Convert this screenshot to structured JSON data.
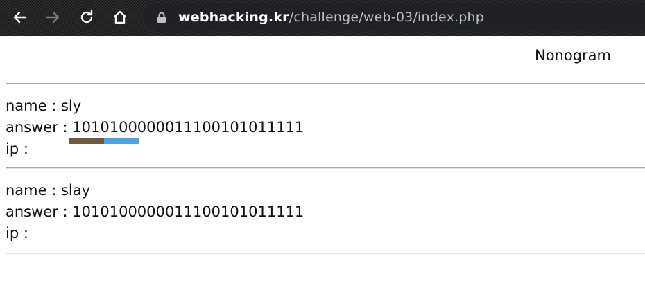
{
  "browser": {
    "url_host": "webhacking.kr",
    "url_path": "/challenge/web-03/index.php",
    "icons": [
      "back-arrow-icon",
      "forward-arrow-icon",
      "reload-icon",
      "home-icon",
      "lock-icon"
    ]
  },
  "page": {
    "title": "Nonogram"
  },
  "entries": [
    {
      "name_line": "name : sly",
      "answer_line": "answer : 1010100000011100101011111",
      "ip_line": "ip :"
    },
    {
      "name_line": "name : slay",
      "answer_line": "answer : 1010100000011100101011111",
      "ip_line": "ip :"
    }
  ],
  "colors": {
    "bar_brown": "#6e5a3e",
    "bar_blue": "#4ca3e3"
  }
}
